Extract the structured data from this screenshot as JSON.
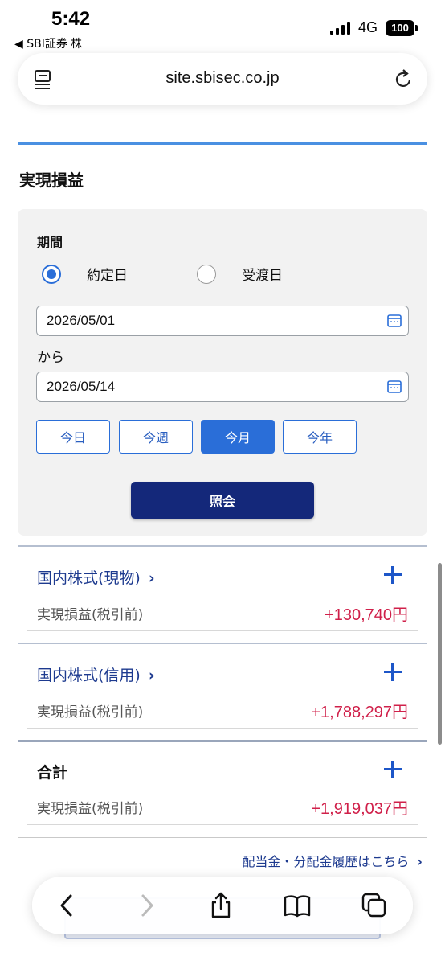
{
  "status_bar": {
    "time": "5:42",
    "back_app": "◀ SBI証券 株",
    "network": "4G",
    "battery": "100"
  },
  "browser": {
    "url": "site.sbisec.co.jp"
  },
  "page": {
    "title": "実現損益"
  },
  "search_form": {
    "period_label": "期間",
    "radio_options": [
      {
        "label": "約定日",
        "checked": true
      },
      {
        "label": "受渡日",
        "checked": false
      }
    ],
    "from_date": "2026/05/01",
    "separator": "から",
    "to_date": "2026/05/14",
    "quick_buttons": [
      {
        "label": "今日",
        "active": false
      },
      {
        "label": "今週",
        "active": false
      },
      {
        "label": "今月",
        "active": true
      },
      {
        "label": "今年",
        "active": false
      }
    ],
    "submit_label": "照会"
  },
  "results": [
    {
      "category": "国内株式(現物)",
      "row_label": "実現損益(税引前)",
      "value": "+130,740円"
    },
    {
      "category": "国内株式(信用)",
      "row_label": "実現損益(税引前)",
      "value": "+1,788,297円"
    },
    {
      "category": "合計",
      "row_label": "実現損益(税引前)",
      "value": "+1,919,037円"
    }
  ],
  "dividend_link": "配当金・分配金履歴はこちら",
  "colors": {
    "accent_blue": "#2a6ed8",
    "navy": "#14287a",
    "link": "#1d3a8f",
    "profit": "#d0204a"
  }
}
